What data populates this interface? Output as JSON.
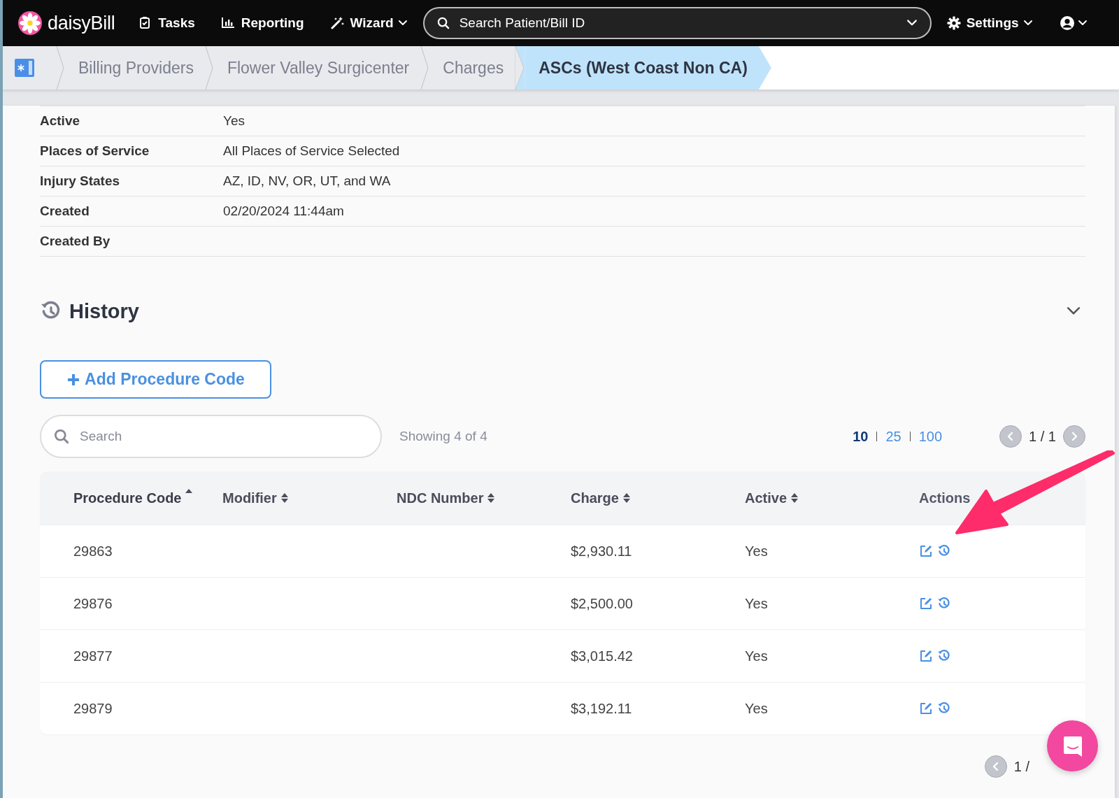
{
  "nav": {
    "logo": "daisy**Bill**",
    "items": [
      {
        "label": "Tasks",
        "dropdown": false
      },
      {
        "label": "Reporting",
        "dropdown": false
      },
      {
        "label": "Wizard",
        "dropdown": true
      }
    ],
    "search": {
      "placeholder": "Search Patient/Bill ID"
    },
    "settings": {
      "label": "Settings"
    }
  },
  "breadcrumb": [
    {
      "label": "Billing Providers",
      "selected": false
    },
    {
      "label": "Flower Valley Surgicenter",
      "selected": false
    },
    {
      "label": "Charges",
      "selected": false
    },
    {
      "label": "ASCs (West Coast Non CA)",
      "selected": true
    }
  ],
  "details": [
    {
      "label": "Active",
      "value": "Yes"
    },
    {
      "label": "Places of Service",
      "value": "All Places of Service Selected"
    },
    {
      "label": "Injury States",
      "value": "AZ, ID, NV, OR, UT, and WA"
    },
    {
      "label": "Created",
      "value": "02/20/2024 11:44am"
    },
    {
      "label": "Created By"
    }
  ],
  "history": {
    "title": "History",
    "expanded": false
  },
  "add_button": {
    "label": "Add Procedure Code"
  },
  "table_search": {
    "placeholder": "Search"
  },
  "showing": "Showing 4 of 4",
  "page_sizes": [
    {
      "label": "10",
      "selected": true
    },
    {
      "label": "25",
      "selected": false
    },
    {
      "label": "100",
      "selected": false
    }
  ],
  "pager": {
    "text": "1 / 1"
  },
  "table": {
    "columns": [
      {
        "label": "Procedure Code",
        "sortable": true,
        "sorted": true
      },
      {
        "label": "Modifier",
        "sortable": true,
        "sorted": false
      },
      {
        "label": "NDC Number",
        "sortable": true,
        "sorted": false
      },
      {
        "label": "Charge",
        "sortable": true,
        "sorted": false
      },
      {
        "label": "Active",
        "sortable": true,
        "sorted": false
      },
      {
        "label": "Actions",
        "sortable": false
      }
    ],
    "rows": [
      {
        "procedure_code": "29863",
        "charge": "$2,930.11",
        "active": "Yes"
      },
      {
        "procedure_code": "29876",
        "charge": "$2,500.00",
        "active": "Yes"
      },
      {
        "procedure_code": "29877",
        "charge": "$3,015.42",
        "active": "Yes"
      },
      {
        "procedure_code": "29879",
        "charge": "$3,192.11",
        "active": "Yes"
      }
    ]
  },
  "bottom_pager": {
    "text": "1 /"
  }
}
